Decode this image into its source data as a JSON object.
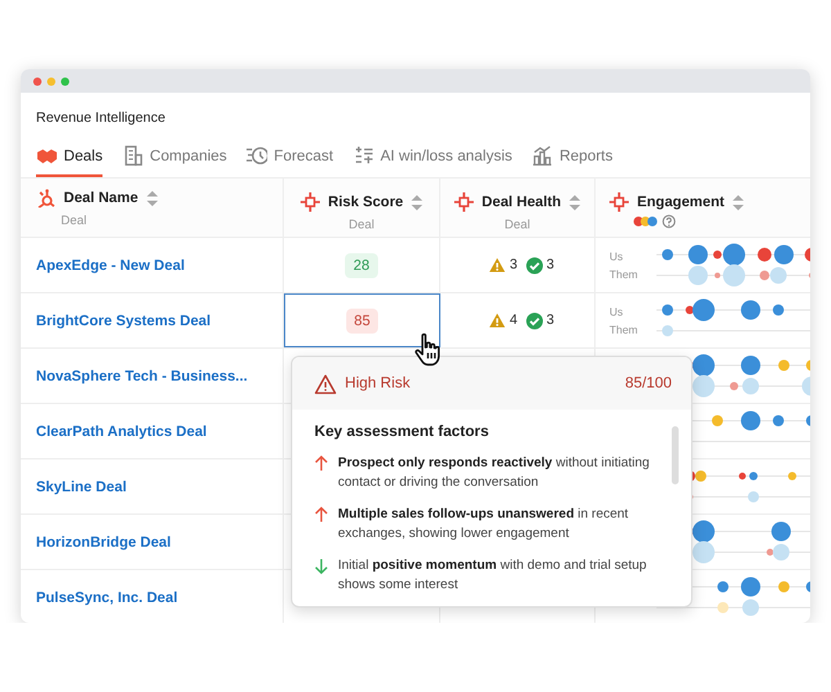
{
  "window": {
    "title": "Revenue Intelligence"
  },
  "tabs": [
    {
      "label": "Deals",
      "selected": true
    },
    {
      "label": "Companies",
      "selected": false
    },
    {
      "label": "Forecast",
      "selected": false
    },
    {
      "label": "AI win/loss analysis",
      "selected": false
    },
    {
      "label": "Reports",
      "selected": false
    }
  ],
  "columns": [
    {
      "label": "Deal Name",
      "sub": "Deal"
    },
    {
      "label": "Risk Score",
      "sub": "Deal"
    },
    {
      "label": "Deal Health",
      "sub": "Deal"
    },
    {
      "label": "Engagement"
    }
  ],
  "rows": [
    {
      "name": "ApexEdge - New Deal",
      "risk": {
        "value": "28",
        "kind": "low",
        "selected": false
      },
      "health": {
        "warnings": "3",
        "passes": "3"
      },
      "engagement": {
        "us": "Us",
        "them": "Them"
      }
    },
    {
      "name": "BrightCore Systems Deal",
      "risk": {
        "value": "85",
        "kind": "high",
        "selected": true
      },
      "health": {
        "warnings": "4",
        "passes": "3"
      },
      "engagement": {
        "us": "Us",
        "them": "Them"
      }
    },
    {
      "name": "NovaSphere Tech - Business..."
    },
    {
      "name": "ClearPath Analytics Deal"
    },
    {
      "name": "SkyLine Deal"
    },
    {
      "name": "HorizonBridge Deal"
    },
    {
      "name": "PulseSync, Inc. Deal"
    }
  ],
  "tooltip": {
    "title": "High Risk",
    "score": "85/100",
    "heading": "Key assessment factors",
    "factors": [
      {
        "kind": "up",
        "text": "**Prospect only responds reactively** without initiating contact or driving the conversation"
      },
      {
        "kind": "up",
        "text": "**Multiple sales follow-ups unanswered** in recent exchanges, showing lower engagement"
      },
      {
        "kind": "down",
        "text": "Initial **positive momentum** with demo and trial setup shows some interest"
      }
    ]
  }
}
